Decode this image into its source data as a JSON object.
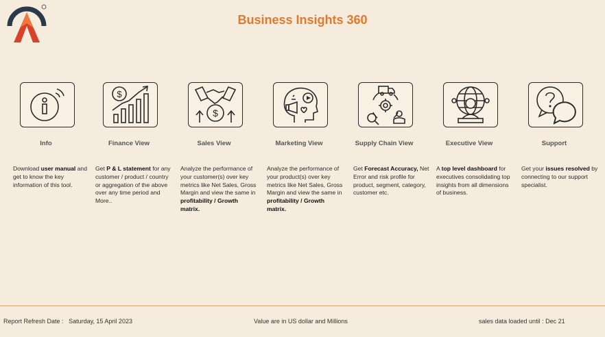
{
  "header": {
    "title": "Business Insights 360"
  },
  "tiles": [
    {
      "label": "Info",
      "icon": "info-icon",
      "desc": [
        {
          "t": "Download "
        },
        {
          "t": "user manual",
          "b": true
        },
        {
          "t": " and get to know the key information of this tool."
        }
      ]
    },
    {
      "label": "Finance View",
      "icon": "finance-growth-icon",
      "desc": [
        {
          "t": "Get  "
        },
        {
          "t": "P & L statement",
          "b": true
        },
        {
          "t": " for any customer / product / country or aggregation of the above over any time period and More.."
        }
      ]
    },
    {
      "label": "Sales View",
      "icon": "handshake-dollar-icon",
      "desc": [
        {
          "t": "Analyze the performance of your customer(s) over key metrics like Net Sales, Gross Margin and view the same in "
        },
        {
          "t": "profitability / Growth matrix.",
          "b": true
        }
      ]
    },
    {
      "label": "Marketing View",
      "icon": "megaphone-head-icon",
      "desc": [
        {
          "t": "Analyze the performance of your product(s) over key metrics like Net Sales, Gross Margin and view the same in "
        },
        {
          "t": "profitability / Growth matrix.",
          "b": true
        }
      ]
    },
    {
      "label": "Supply Chain View",
      "icon": "supply-chain-icon",
      "desc": [
        {
          "t": "Get "
        },
        {
          "t": "Forecast Accuracy,",
          "b": true
        },
        {
          "t": " Net Error and risk profile for product, segment, category, customer etc."
        }
      ]
    },
    {
      "label": "Executive View",
      "icon": "executive-globe-icon",
      "desc": [
        {
          "t": "A "
        },
        {
          "t": "top level dashboard",
          "b": true
        },
        {
          "t": " for executives consolidating top insights from all dimensions of business."
        }
      ]
    },
    {
      "label": "Support",
      "icon": "support-chat-icon",
      "desc": [
        {
          "t": "Get your "
        },
        {
          "t": "issues resolved",
          "b": true
        },
        {
          "t": " by connecting to our support specialist."
        }
      ]
    }
  ],
  "footer": {
    "refresh_label": "Report Refresh Date :",
    "refresh_date": "Saturday, 15 April 2023",
    "units_note": "Value are in US dollar and Millions",
    "loaded_until": "sales data loaded until : Dec 21"
  },
  "colors": {
    "accent": "#e07a2e",
    "background": "#f6ecdd",
    "logo_dark": "#2b3a4a",
    "logo_red": "#d9412b"
  }
}
